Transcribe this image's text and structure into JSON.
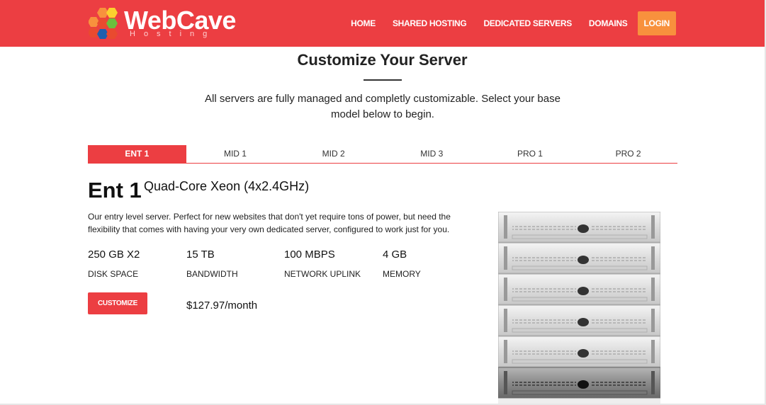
{
  "header": {
    "logo_word": "WebCave",
    "logo_sub": "Hosting",
    "nav": [
      "HOME",
      "SHARED HOSTING",
      "DEDICATED SERVERS",
      "DOMAINS"
    ],
    "login": "LOGIN"
  },
  "section": {
    "title": "Customize Your Server",
    "subtitle": "All servers are fully managed and completly customizable. Select your base model below to begin."
  },
  "tabs": [
    "ENT 1",
    "MID 1",
    "MID 2",
    "MID 3",
    "PRO 1",
    "PRO 2"
  ],
  "product": {
    "name": "Ent 1",
    "cpu": "Quad-Core Xeon (4x2.4GHz)",
    "description": "Our entry level server. Perfect for new websites that don't yet require tons of power, but need the flexibility that comes with having your very own dedicated server, configured to work just for you.",
    "specs": [
      {
        "value": "250 GB X2",
        "label": "DISK SPACE"
      },
      {
        "value": "15 TB",
        "label": "BANDWIDTH"
      },
      {
        "value": "100 MBPS",
        "label": "NETWORK UPLINK"
      },
      {
        "value": "4 GB",
        "label": "MEMORY"
      }
    ],
    "button": "CUSTOMIZE",
    "price": "$127.97/month"
  },
  "colors": {
    "brand_red": "#ec3e42",
    "login_orange": "#f8913d"
  }
}
